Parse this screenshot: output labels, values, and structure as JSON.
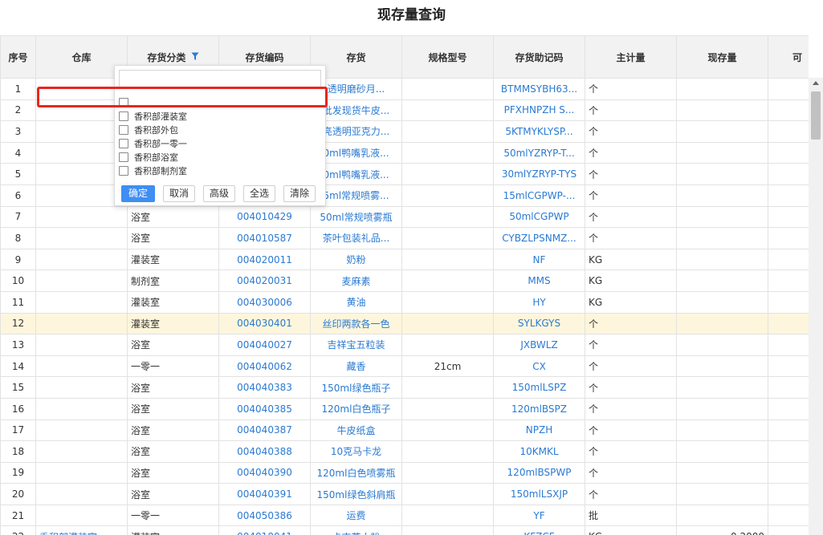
{
  "page": {
    "title": "现存量查询"
  },
  "columns": [
    {
      "key": "idx",
      "label": "序号"
    },
    {
      "key": "warehouse",
      "label": "仓库"
    },
    {
      "key": "category",
      "label": "存货分类"
    },
    {
      "key": "code",
      "label": "存货编码"
    },
    {
      "key": "name",
      "label": "存货"
    },
    {
      "key": "spec",
      "label": "规格型号"
    },
    {
      "key": "mnemonic",
      "label": "存货助记码"
    },
    {
      "key": "unit",
      "label": "主计量"
    },
    {
      "key": "stock",
      "label": "现存量"
    },
    {
      "key": "avail",
      "label": "可"
    }
  ],
  "rows": [
    {
      "idx": "1",
      "warehouse": "",
      "category": "",
      "code": "",
      "name": "透明磨砂月...",
      "spec": "",
      "mnemonic": "BTMMSYBH63...",
      "unit": "个",
      "stock": "",
      "avail": ""
    },
    {
      "idx": "2",
      "warehouse": "",
      "category": "",
      "code": "",
      "name": "批发现货牛皮...",
      "spec": "",
      "mnemonic": "PFXHNPZH S...",
      "unit": "个",
      "stock": "",
      "avail": ""
    },
    {
      "idx": "3",
      "warehouse": "",
      "category": "",
      "code": "",
      "name": "亮透明亚克力...",
      "spec": "",
      "mnemonic": "5KTMYKLYSP...",
      "unit": "个",
      "stock": "",
      "avail": ""
    },
    {
      "idx": "4",
      "warehouse": "",
      "category": "",
      "code": "",
      "name": "0ml鸭嘴乳液...",
      "spec": "",
      "mnemonic": "50mlYZRYP-T...",
      "unit": "个",
      "stock": "",
      "avail": ""
    },
    {
      "idx": "5",
      "warehouse": "",
      "category": "",
      "code": "",
      "name": "0ml鸭嘴乳液...",
      "spec": "",
      "mnemonic": "30mlYZRYP-TYS",
      "unit": "个",
      "stock": "",
      "avail": ""
    },
    {
      "idx": "6",
      "warehouse": "",
      "category": "",
      "code": "",
      "name": "5ml常规喷雾...",
      "spec": "",
      "mnemonic": "15mlCGPWP-...",
      "unit": "个",
      "stock": "",
      "avail": ""
    },
    {
      "idx": "7",
      "warehouse": "",
      "category": "浴室",
      "code": "004010429",
      "name": "50ml常规喷雾瓶",
      "spec": "",
      "mnemonic": "50mlCGPWP",
      "unit": "个",
      "stock": "",
      "avail": ""
    },
    {
      "idx": "8",
      "warehouse": "",
      "category": "浴室",
      "code": "004010587",
      "name": "茶叶包装礼品...",
      "spec": "",
      "mnemonic": "CYBZLPSNMZ...",
      "unit": "个",
      "stock": "",
      "avail": ""
    },
    {
      "idx": "9",
      "warehouse": "",
      "category": "灌装室",
      "code": "004020011",
      "name": "奶粉",
      "spec": "",
      "mnemonic": "NF",
      "unit": "KG",
      "stock": "",
      "avail": ""
    },
    {
      "idx": "10",
      "warehouse": "",
      "category": "制剂室",
      "code": "004020031",
      "name": "麦麻素",
      "spec": "",
      "mnemonic": "MMS",
      "unit": "KG",
      "stock": "",
      "avail": ""
    },
    {
      "idx": "11",
      "warehouse": "",
      "category": "灌装室",
      "code": "004030006",
      "name": "黄油",
      "spec": "",
      "mnemonic": "HY",
      "unit": "KG",
      "stock": "",
      "avail": ""
    },
    {
      "idx": "12",
      "warehouse": "",
      "category": "灌装室",
      "code": "004030401",
      "name": "丝印两款各一色",
      "spec": "",
      "mnemonic": "SYLKGYS",
      "unit": "个",
      "stock": "",
      "avail": "",
      "highlight": true
    },
    {
      "idx": "13",
      "warehouse": "",
      "category": "浴室",
      "code": "004040027",
      "name": "吉祥宝五粒装",
      "spec": "",
      "mnemonic": "JXBWLZ",
      "unit": "个",
      "stock": "",
      "avail": ""
    },
    {
      "idx": "14",
      "warehouse": "",
      "category": "一零一",
      "code": "004040062",
      "name": "藏香",
      "spec": "21cm",
      "mnemonic": "CX",
      "unit": "个",
      "stock": "",
      "avail": ""
    },
    {
      "idx": "15",
      "warehouse": "",
      "category": "浴室",
      "code": "004040383",
      "name": "150ml绿色瓶子",
      "spec": "",
      "mnemonic": "150mlLSPZ",
      "unit": "个",
      "stock": "",
      "avail": ""
    },
    {
      "idx": "16",
      "warehouse": "",
      "category": "浴室",
      "code": "004040385",
      "name": "120ml白色瓶子",
      "spec": "",
      "mnemonic": "120mlBSPZ",
      "unit": "个",
      "stock": "",
      "avail": ""
    },
    {
      "idx": "17",
      "warehouse": "",
      "category": "浴室",
      "code": "004040387",
      "name": "牛皮纸盒",
      "spec": "",
      "mnemonic": "NPZH",
      "unit": "个",
      "stock": "",
      "avail": ""
    },
    {
      "idx": "18",
      "warehouse": "",
      "category": "浴室",
      "code": "004040388",
      "name": "10克马卡龙",
      "spec": "",
      "mnemonic": "10KMKL",
      "unit": "个",
      "stock": "",
      "avail": ""
    },
    {
      "idx": "19",
      "warehouse": "",
      "category": "浴室",
      "code": "004040390",
      "name": "120ml白色喷雾瓶",
      "spec": "",
      "mnemonic": "120mlBSPWP",
      "unit": "个",
      "stock": "",
      "avail": ""
    },
    {
      "idx": "20",
      "warehouse": "",
      "category": "浴室",
      "code": "004040391",
      "name": "150ml绿色斜肩瓶",
      "spec": "",
      "mnemonic": "150mlLSXJP",
      "unit": "个",
      "stock": "",
      "avail": ""
    },
    {
      "idx": "21",
      "warehouse": "",
      "category": "一零一",
      "code": "004050386",
      "name": "运费",
      "spec": "",
      "mnemonic": "YF",
      "unit": "批",
      "stock": "",
      "avail": ""
    },
    {
      "idx": "22",
      "warehouse": "香积部灌装室",
      "category": "灌装室",
      "code": "004010041",
      "name": "卡吉茶小粉",
      "spec": "",
      "mnemonic": "KFZCF",
      "unit": "KG",
      "stock": "0.2000",
      "avail": ""
    }
  ],
  "filter_popup": {
    "search_placeholder": "",
    "options": [
      {
        "label": ""
      },
      {
        "label": "香积部灌装室"
      },
      {
        "label": "香积部外包"
      },
      {
        "label": "香积部一零一"
      },
      {
        "label": "香积部浴室"
      },
      {
        "label": "香积部制剂室"
      }
    ],
    "buttons": {
      "confirm": "确定",
      "cancel": "取消",
      "advanced": "高级",
      "select_all": "全选",
      "clear": "清除"
    }
  },
  "colors": {
    "link_blue": "#2a7ad2",
    "header_bg": "#f2f2f2",
    "highlight_row": "#fdf6dc",
    "primary_button": "#3f8ef3",
    "annotation_red": "#e8261f"
  }
}
